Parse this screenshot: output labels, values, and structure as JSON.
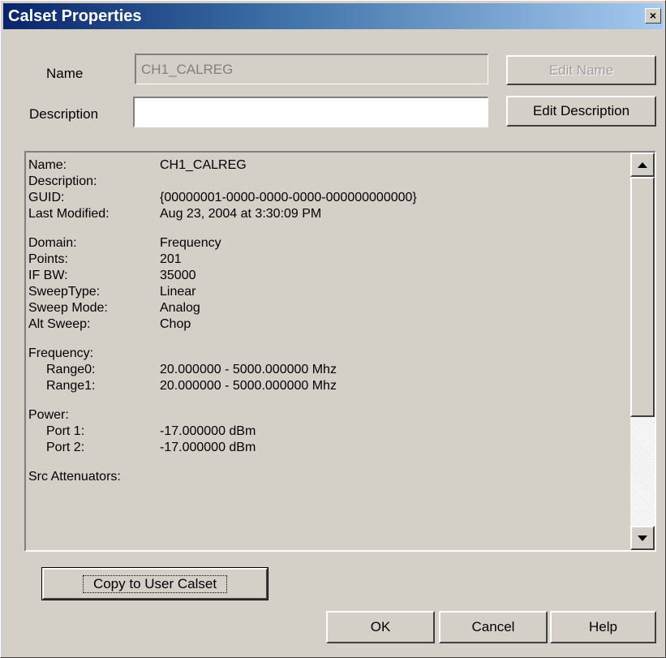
{
  "window": {
    "title": "Calset Properties",
    "close_glyph": "×"
  },
  "form": {
    "name_label": "Name",
    "name_value": "CH1_CALREG",
    "description_label": "Description",
    "description_value": "",
    "edit_name_label": "Edit Name",
    "edit_description_label": "Edit Description"
  },
  "info": [
    {
      "key": "Name:",
      "value": "CH1_CALREG",
      "indent": false
    },
    {
      "key": "Description:",
      "value": "",
      "indent": false
    },
    {
      "key": "GUID:",
      "value": "{00000001-0000-0000-0000-000000000000}",
      "indent": false
    },
    {
      "key": "Last Modified:",
      "value": "Aug 23, 2004 at 3:30:09 PM",
      "indent": false
    },
    {
      "gap": true
    },
    {
      "key": "Domain:",
      "value": "Frequency",
      "indent": false
    },
    {
      "key": "Points:",
      "value": "201",
      "indent": false
    },
    {
      "key": "IF BW:",
      "value": "35000",
      "indent": false
    },
    {
      "key": "SweepType:",
      "value": "Linear",
      "indent": false
    },
    {
      "key": "Sweep Mode:",
      "value": "Analog",
      "indent": false
    },
    {
      "key": "Alt Sweep:",
      "value": "Chop",
      "indent": false
    },
    {
      "gap": true
    },
    {
      "key": "Frequency:",
      "value": "",
      "indent": false
    },
    {
      "key": "Range0:",
      "value": "20.000000 - 5000.000000 Mhz",
      "indent": true
    },
    {
      "key": "Range1:",
      "value": "20.000000 - 5000.000000 Mhz",
      "indent": true
    },
    {
      "gap": true
    },
    {
      "key": "Power:",
      "value": "",
      "indent": false
    },
    {
      "key": "Port 1:",
      "value": "-17.000000 dBm",
      "indent": true
    },
    {
      "key": "Port 2:",
      "value": "-17.000000 dBm",
      "indent": true
    },
    {
      "gap": true
    },
    {
      "key": "Src Attenuators:",
      "value": "",
      "indent": false
    }
  ],
  "buttons": {
    "copy_label": "Copy to User Calset",
    "ok_label": "OK",
    "cancel_label": "Cancel",
    "help_label": "Help"
  },
  "icons": {
    "close": "close-icon",
    "scroll_up": "triangle-up-icon",
    "scroll_down": "triangle-down-icon"
  },
  "colors": {
    "titlebar_start": "#0a246a",
    "titlebar_end": "#a6caf0",
    "dialog_face": "#d4d0c8"
  }
}
